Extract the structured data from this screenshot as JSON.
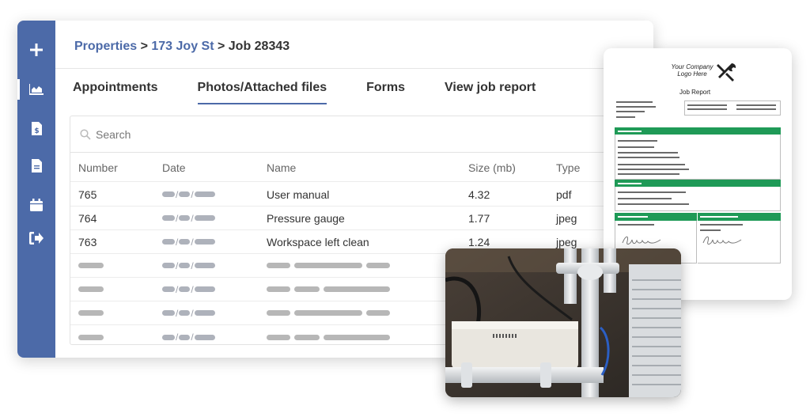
{
  "breadcrumb": {
    "part1": "Properties",
    "sep1": " > ",
    "part2": "173 Joy St",
    "sep2": " > ",
    "current": "Job 28343"
  },
  "sidebar": {
    "items": [
      {
        "icon": "plus-icon"
      },
      {
        "icon": "chart-area-icon",
        "active": true
      },
      {
        "icon": "invoice-icon"
      },
      {
        "icon": "document-icon"
      },
      {
        "icon": "calendar-icon"
      },
      {
        "icon": "sign-out-icon"
      }
    ],
    "color": "#4c6aa8"
  },
  "tabs": [
    {
      "label": "Appointments"
    },
    {
      "label": "Photos/Attached files",
      "active": true
    },
    {
      "label": "Forms"
    },
    {
      "label": "View job report"
    }
  ],
  "search": {
    "placeholder": "Search"
  },
  "table": {
    "headers": {
      "number": "Number",
      "date": "Date",
      "name": "Name",
      "size": "Size (mb)",
      "type": "Type"
    },
    "rows": [
      {
        "number": "765",
        "name": "User manual",
        "size": "4.32",
        "type": "pdf"
      },
      {
        "number": "764",
        "name": "Pressure gauge",
        "size": "1.77",
        "type": "jpeg"
      },
      {
        "number": "763",
        "name": "Workspace left clean",
        "size": "1.24",
        "type": "jpeg"
      }
    ],
    "placeholder_row_count": 4
  },
  "report": {
    "logo_line1": "Your Company",
    "logo_line2": "Logo Here",
    "title": "Job Report",
    "accent": "#1f9a57"
  }
}
